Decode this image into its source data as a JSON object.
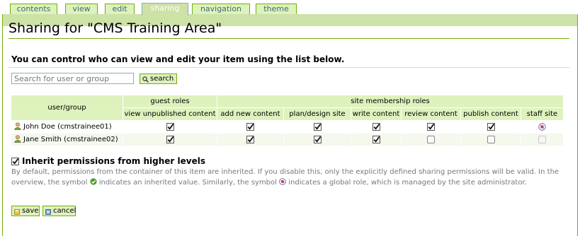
{
  "tabs": [
    {
      "label": "contents",
      "active": false
    },
    {
      "label": "view",
      "active": false
    },
    {
      "label": "edit",
      "active": false
    },
    {
      "label": "sharing",
      "active": true
    },
    {
      "label": "navigation",
      "active": false
    },
    {
      "label": "theme",
      "active": false
    }
  ],
  "page": {
    "title": "Sharing for \"CMS Training Area\"",
    "description": "You can control who can view and edit your item using the list below."
  },
  "search": {
    "placeholder": "Search for user or group",
    "button_label": "search"
  },
  "table": {
    "user_group_header": "user/group",
    "guest_roles_header": "guest roles",
    "site_roles_header": "site membership roles",
    "columns": [
      "view unpublished content",
      "add new content",
      "plan/design site",
      "write content",
      "review content",
      "publish content",
      "staff site"
    ],
    "rows": [
      {
        "name": "John Doe (cmstrainee01)",
        "perms": [
          "checked",
          "checked",
          "checked",
          "checked",
          "checked",
          "checked",
          "global"
        ]
      },
      {
        "name": "Jane Smith (cmstrainee02)",
        "perms": [
          "checked",
          "checked",
          "checked",
          "checked",
          "unchecked",
          "unchecked",
          "disabled"
        ]
      }
    ]
  },
  "inherit": {
    "label": "Inherit permissions from higher levels",
    "checked": true,
    "help_part1": "By default, permissions from the container of this item are inherited. If you disable this, only the explicitly defined sharing permissions will be valid. In the overview, the symbol",
    "help_part2": "indicates an inherited value. Similarly, the symbol",
    "help_part3": "indicates a global role, which is managed by the site administrator."
  },
  "actions": {
    "save_label": "save",
    "cancel_label": "cancel"
  },
  "colors": {
    "accent_green": "#74ae0b",
    "tab_bg": "#def2bd",
    "active_tab_bg": "#cde2a7",
    "header_bg": "#def2bd"
  }
}
